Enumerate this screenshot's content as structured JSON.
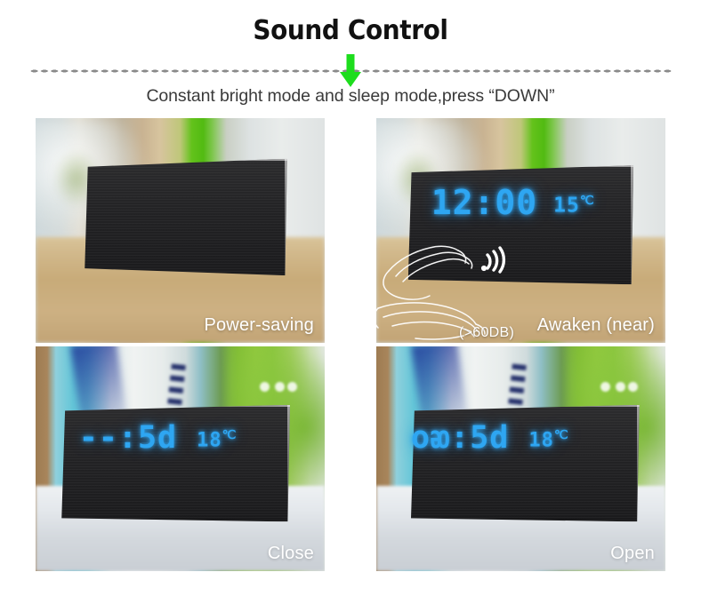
{
  "header": {
    "title": "Sound Control",
    "subtitle": "Constant bright mode and sleep mode,press  “DOWN”",
    "arrow_icon": "arrow-down-icon",
    "arrow_color": "#1ddd1d",
    "divider_color": "#8a8a8a"
  },
  "theme": {
    "led_blue": "#2ea6f2",
    "caption_white": "#ffffff",
    "title_black": "#111111",
    "subtitle_gray": "#3a3a3a",
    "page_background": "#ffffff"
  },
  "panels": [
    {
      "id": "power-saving",
      "caption": "Power-saving",
      "display": {
        "time": "",
        "temp": "",
        "degree": ""
      },
      "has_display": false,
      "scene": "wood-table-blurred-kitchen"
    },
    {
      "id": "awaken-near",
      "caption": "Awaken (near)",
      "display": {
        "time": "12:00",
        "temp": "15",
        "degree": "℃"
      },
      "has_display": true,
      "scene": "wood-table-blurred-kitchen",
      "overlay": {
        "sound_icon": "sound-wave-icon",
        "hands_icon": "clapping-hands-icon",
        "db_label": "(>60DB)"
      }
    },
    {
      "id": "close",
      "caption": "Close",
      "display": {
        "time": "--:5d",
        "temp": "18",
        "degree": "℃"
      },
      "has_display": true,
      "scene": "white-desk-blurred-teal-plant"
    },
    {
      "id": "open",
      "caption": "Open",
      "display": {
        "time": "oᴔ:5d",
        "temp": "18",
        "degree": "℃"
      },
      "has_display": true,
      "scene": "white-desk-blurred-teal-plant"
    }
  ]
}
